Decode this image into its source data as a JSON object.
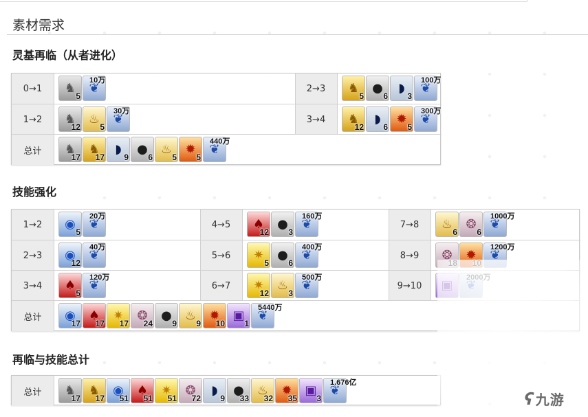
{
  "section_title": "素材需求",
  "ascension": {
    "title": "灵基再临（从者进化）",
    "rows": [
      [
        {
          "label": "0→1",
          "items": [
            {
              "icon": "silver-piece",
              "count": "5"
            }
          ],
          "qp": "10万"
        },
        {
          "label": "2→3",
          "items": [
            {
              "icon": "gold-piece",
              "count": "5"
            },
            {
              "icon": "black-pot",
              "count": "6"
            },
            {
              "icon": "black-feather",
              "count": "3"
            }
          ],
          "qp": "100万"
        }
      ],
      [
        {
          "label": "1→2",
          "items": [
            {
              "icon": "silver-piece",
              "count": "12"
            },
            {
              "icon": "gold-lamp",
              "count": "5"
            }
          ],
          "qp": "30万"
        },
        {
          "label": "3→4",
          "items": [
            {
              "icon": "gold-piece",
              "count": "12"
            },
            {
              "icon": "black-feather",
              "count": "6"
            },
            {
              "icon": "fire-seed",
              "count": "5"
            }
          ],
          "qp": "300万"
        }
      ]
    ],
    "total": {
      "label": "总计",
      "items": [
        {
          "icon": "silver-piece",
          "count": "17"
        },
        {
          "icon": "gold-piece",
          "count": "17"
        },
        {
          "icon": "black-feather",
          "count": "9"
        },
        {
          "icon": "black-pot",
          "count": "6"
        },
        {
          "icon": "gold-lamp",
          "count": "5"
        },
        {
          "icon": "fire-seed",
          "count": "5"
        }
      ],
      "qp": "440万"
    }
  },
  "skill": {
    "title": "技能强化",
    "rows": [
      [
        {
          "label": "1→2",
          "items": [
            {
              "icon": "blue-gem",
              "count": "5"
            }
          ],
          "qp": "20万"
        },
        {
          "label": "4→5",
          "items": [
            {
              "icon": "red-gem",
              "count": "12"
            },
            {
              "icon": "black-pot",
              "count": "3"
            }
          ],
          "qp": "160万"
        },
        {
          "label": "7→8",
          "items": [
            {
              "icon": "gold-lamp",
              "count": "6"
            },
            {
              "icon": "conch-shell",
              "count": "6"
            }
          ],
          "qp": "1000万"
        }
      ],
      [
        {
          "label": "2→3",
          "items": [
            {
              "icon": "blue-gem",
              "count": "12"
            }
          ],
          "qp": "40万"
        },
        {
          "label": "5→6",
          "items": [
            {
              "icon": "gold-star",
              "count": "5"
            },
            {
              "icon": "black-pot",
              "count": "6"
            }
          ],
          "qp": "400万"
        },
        {
          "label": "8→9",
          "items": [
            {
              "icon": "conch-shell",
              "count": "18"
            },
            {
              "icon": "fire-seed",
              "count": "10"
            }
          ],
          "qp": "1200万"
        }
      ],
      [
        {
          "label": "3→4",
          "items": [
            {
              "icon": "red-gem",
              "count": "5"
            }
          ],
          "qp": "120万"
        },
        {
          "label": "6→7",
          "items": [
            {
              "icon": "gold-star",
              "count": "12"
            },
            {
              "icon": "gold-lamp",
              "count": "3"
            }
          ],
          "qp": "500万"
        },
        {
          "label": "9→10",
          "items": [
            {
              "icon": "purple-cube",
              "count": ""
            }
          ],
          "qp": "2000万"
        }
      ]
    ],
    "total": {
      "label": "总计",
      "items": [
        {
          "icon": "blue-gem",
          "count": "17"
        },
        {
          "icon": "red-gem",
          "count": "17"
        },
        {
          "icon": "gold-star",
          "count": "17"
        },
        {
          "icon": "conch-shell",
          "count": "24"
        },
        {
          "icon": "black-pot",
          "count": "9"
        },
        {
          "icon": "gold-lamp",
          "count": "9"
        },
        {
          "icon": "fire-seed",
          "count": "10"
        },
        {
          "icon": "purple-cube",
          "count": "1"
        }
      ],
      "qp": "5440万"
    }
  },
  "grand": {
    "title": "再临与技能总计",
    "total": {
      "label": "总计",
      "items": [
        {
          "icon": "silver-piece",
          "count": "17"
        },
        {
          "icon": "gold-piece",
          "count": "17"
        },
        {
          "icon": "blue-gem",
          "count": "51"
        },
        {
          "icon": "red-gem",
          "count": "51"
        },
        {
          "icon": "gold-star",
          "count": "51"
        },
        {
          "icon": "conch-shell",
          "count": "72"
        },
        {
          "icon": "black-feather",
          "count": "9"
        },
        {
          "icon": "black-pot",
          "count": "33"
        },
        {
          "icon": "gold-lamp",
          "count": "32"
        },
        {
          "icon": "fire-seed",
          "count": "35"
        },
        {
          "icon": "purple-cube",
          "count": "3"
        }
      ],
      "qp": "1.676亿"
    }
  },
  "watermark": "九游"
}
